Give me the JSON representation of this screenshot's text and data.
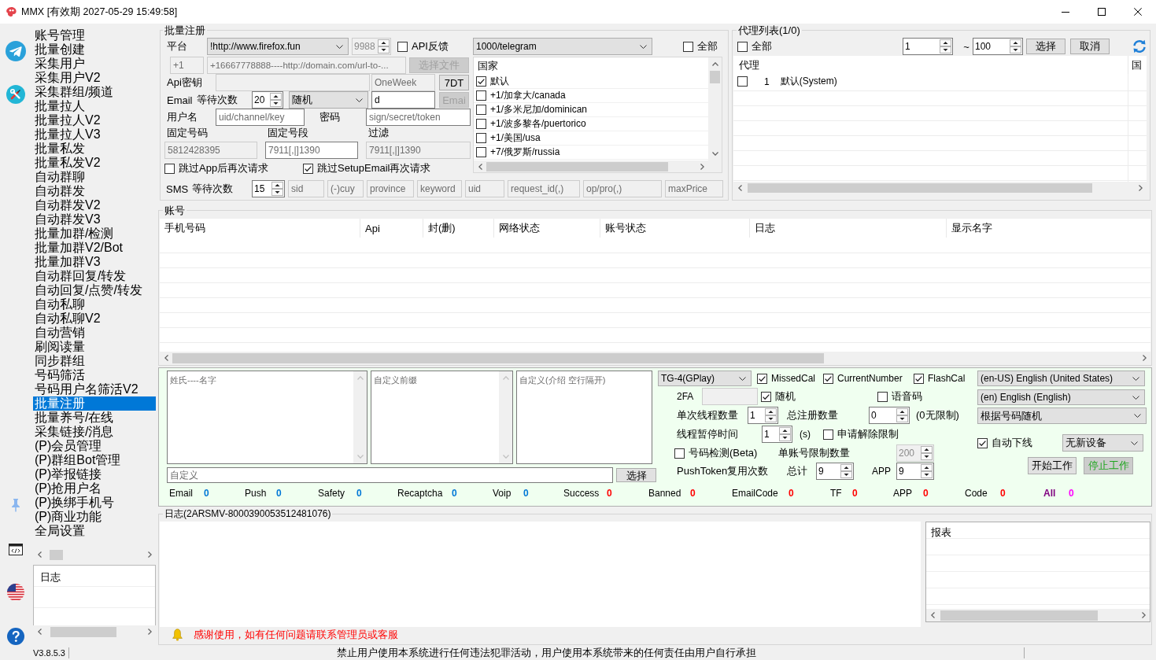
{
  "window": {
    "title": "MMX [有效期 2027-05-29 15:49:58]"
  },
  "sidebar": {
    "items": [
      {
        "label": "账号管理",
        "selected": false
      },
      {
        "label": "批量创建",
        "selected": false
      },
      {
        "label": "采集用户",
        "selected": false
      },
      {
        "label": "采集用户V2",
        "selected": false
      },
      {
        "label": "采集群组/频道",
        "selected": false
      },
      {
        "label": "批量拉人",
        "selected": false
      },
      {
        "label": "批量拉人V2",
        "selected": false
      },
      {
        "label": "批量拉人V3",
        "selected": false
      },
      {
        "label": "批量私发",
        "selected": false
      },
      {
        "label": "批量私发V2",
        "selected": false
      },
      {
        "label": "自动群聊",
        "selected": false
      },
      {
        "label": "自动群发",
        "selected": false
      },
      {
        "label": "自动群发V2",
        "selected": false
      },
      {
        "label": "自动群发V3",
        "selected": false
      },
      {
        "label": "批量加群/检测",
        "selected": false
      },
      {
        "label": "批量加群V2/Bot",
        "selected": false
      },
      {
        "label": "批量加群V3",
        "selected": false
      },
      {
        "label": "自动群回复/转发",
        "selected": false
      },
      {
        "label": "自动回复/点赞/转发",
        "selected": false
      },
      {
        "label": "自动私聊",
        "selected": false
      },
      {
        "label": "自动私聊V2",
        "selected": false
      },
      {
        "label": "自动营销",
        "selected": false
      },
      {
        "label": "刷阅读量",
        "selected": false
      },
      {
        "label": "同步群组",
        "selected": false
      },
      {
        "label": "号码筛活",
        "selected": false
      },
      {
        "label": "号码用户名筛活V2",
        "selected": false
      },
      {
        "label": "批量注册",
        "selected": true
      },
      {
        "label": "批量养号/在线",
        "selected": false
      },
      {
        "label": "采集链接/消息",
        "selected": false
      },
      {
        "label": "(P)会员管理",
        "selected": false
      },
      {
        "label": "(P)群组Bot管理",
        "selected": false
      },
      {
        "label": "(P)举报链接",
        "selected": false
      },
      {
        "label": "(P)抢用户名",
        "selected": false
      },
      {
        "label": "(P)换绑手机号",
        "selected": false
      },
      {
        "label": "(P)商业功能",
        "selected": false
      },
      {
        "label": "全局设置",
        "selected": false
      }
    ],
    "log": {
      "header": "日志"
    }
  },
  "register": {
    "title": "批量注册",
    "platform": {
      "label": "平台",
      "source": "!http://www.firefox.fun",
      "port": {
        "value": "9988",
        "disabled": true
      },
      "api_feedback": {
        "label": "API反馈",
        "checked": false
      }
    },
    "numbers": {
      "prefix": {
        "placeholder": "+1",
        "disabled": true
      },
      "source": {
        "placeholder": "+16667778888----http://domain.com/url-to-...",
        "disabled": true
      },
      "file_button": {
        "label": "选择文件",
        "disabled": true
      }
    },
    "api_key": {
      "label": "Api密钥",
      "key_field": {
        "disabled": true
      },
      "period": {
        "placeholder": "OneWeek",
        "disabled": true
      },
      "button": {
        "label": "7DT",
        "disabled": false
      }
    },
    "email": {
      "label": "Email",
      "wait_label": "等待次数",
      "wait": {
        "value": "20",
        "disabled": false
      },
      "mode": "随机",
      "domain": {
        "value": "d",
        "disabled": false
      },
      "button": {
        "label": "Emai",
        "disabled": true
      }
    },
    "credentials": {
      "username_label": "用户名",
      "username": {
        "placeholder": "uid/channel/key",
        "disabled": false
      },
      "password_label": "密码",
      "password": {
        "placeholder": "sign/secret/token",
        "disabled": false
      }
    },
    "fixed": [
      {
        "label": "固定号码",
        "field": {
          "placeholder": "5812428395",
          "disabled": true
        }
      },
      {
        "label": "固定号段",
        "field": {
          "placeholder": "7911[,|]1390",
          "disabled": false
        }
      },
      {
        "label": "过滤",
        "field": {
          "placeholder": "7911[,|]1390",
          "disabled": true
        }
      }
    ],
    "skip_options": [
      {
        "label": "跳过App后再次请求",
        "checked": false
      },
      {
        "label": "跳过SetupEmail再次请求",
        "checked": true
      }
    ],
    "app": {
      "value": "1000/telegram",
      "all": {
        "label": "全部",
        "checked": false
      }
    },
    "countries": {
      "header": "国家",
      "items": [
        {
          "label": "默认",
          "checked": true
        },
        {
          "label": "+1/加拿大/canada",
          "checked": false
        },
        {
          "label": "+1/多米尼加/dominican",
          "checked": false
        },
        {
          "label": "+1/波多黎各/puertorico",
          "checked": false
        },
        {
          "label": "+1/美国/usa",
          "checked": false
        },
        {
          "label": "+7/俄罗斯/russia",
          "checked": false
        }
      ]
    },
    "sms": {
      "label": "SMS",
      "wait_label": "等待次数",
      "wait": {
        "value": "15",
        "disabled": false
      },
      "fields": [
        {
          "placeholder": "sid",
          "disabled": true
        },
        {
          "placeholder": "(-)cuy",
          "disabled": true
        },
        {
          "placeholder": "province",
          "disabled": true
        },
        {
          "placeholder": "keyword",
          "disabled": true
        },
        {
          "placeholder": "uid",
          "disabled": true
        },
        {
          "placeholder": "request_id(,)",
          "disabled": true
        },
        {
          "placeholder": "op/pro(,)",
          "disabled": true
        },
        {
          "placeholder": "maxPrice",
          "disabled": true
        }
      ]
    }
  },
  "proxy": {
    "title": "代理列表(1/0)",
    "all": {
      "label": "全部",
      "checked": false
    },
    "range_from": {
      "value": "1",
      "disabled": false
    },
    "range_separator": "~",
    "range_to": {
      "value": "100",
      "disabled": false
    },
    "buttons": [
      {
        "label": "选择",
        "disabled": false
      },
      {
        "label": "取消",
        "disabled": false
      }
    ],
    "columns": [
      "代理",
      "国"
    ],
    "rows": [
      {
        "checked": false,
        "index": "1",
        "name": "默认(System)"
      }
    ]
  },
  "accounts": {
    "title": "账号",
    "columns": [
      "手机号码",
      "Api",
      "封(删)",
      "网络状态",
      "账号状态",
      "日志",
      "显示名字"
    ]
  },
  "settings": {
    "text_areas": [
      {
        "placeholder": "姓氏----名字",
        "scrollable": true
      },
      {
        "placeholder": "自定义前缀",
        "scrollable": true
      },
      {
        "placeholder": "自定义(介绍 空行隔开)",
        "scrollable": false
      }
    ],
    "custom": {
      "field": {
        "placeholder": "自定义",
        "disabled": false
      },
      "button": {
        "label": "选择",
        "disabled": false
      }
    },
    "client": "TG-4(GPlay)",
    "flags": [
      {
        "label": "MissedCal",
        "checked": true
      },
      {
        "label": "CurrentNumber",
        "checked": true
      },
      {
        "label": "FlashCal",
        "checked": true
      }
    ],
    "two_fa": {
      "label": "2FA",
      "field": {
        "disabled": true
      },
      "random": {
        "label": "随机",
        "checked": true
      },
      "voice": {
        "label": "语音码",
        "checked": false
      }
    },
    "threads": {
      "label": "单次线程数量",
      "spin": {
        "value": "1",
        "disabled": false
      }
    },
    "total": {
      "label": "总注册数量",
      "spin": {
        "value": "0",
        "disabled": false
      },
      "note": "(0无限制)"
    },
    "pause": {
      "label": "线程暂停时间",
      "spin": {
        "value": "1",
        "disabled": false
      },
      "unit": "(s)",
      "unlock": {
        "label": "申请解除限制",
        "checked": false
      }
    },
    "number_check": {
      "label": "号码检测(Beta)",
      "checked": false
    },
    "account_limit": {
      "label": "单账号限制数量",
      "spin": {
        "value": "200",
        "disabled": true
      }
    },
    "push_token": {
      "label": "PushToken复用次数",
      "total_label": "总计",
      "total": {
        "value": "9",
        "disabled": false
      },
      "app_label": "APP",
      "app": {
        "value": "9",
        "disabled": false
      }
    },
    "languages": [
      "(en-US) English (United States)",
      "(en) English (English)",
      "根据号码随机"
    ],
    "auto_logout": {
      "label": "自动下线",
      "checked": true,
      "device": "无新设备"
    },
    "actions": [
      {
        "label": "开始工作",
        "kind": "start"
      },
      {
        "label": "停止工作",
        "kind": "stop"
      }
    ],
    "stats": [
      {
        "label": "Email",
        "value": "0",
        "color": "#0078d7",
        "kind": "count"
      },
      {
        "label": "Push",
        "value": "0",
        "color": "#0078d7",
        "kind": "count"
      },
      {
        "label": "Safety",
        "value": "0",
        "color": "#0078d7",
        "kind": "count"
      },
      {
        "label": "Recaptcha",
        "value": "0",
        "color": "#0078d7",
        "kind": "count"
      },
      {
        "label": "Voip",
        "value": "0",
        "color": "#0078d7",
        "kind": "count"
      },
      {
        "label": "Success",
        "value": "0",
        "color": "#ff0000",
        "kind": "count"
      },
      {
        "label": "Banned",
        "value": "0",
        "color": "#ff0000",
        "kind": "count"
      },
      {
        "label": "EmailCode",
        "value": "0",
        "color": "#ff0000",
        "kind": "count"
      },
      {
        "label": "TF",
        "value": "0",
        "color": "#ff0000",
        "kind": "count"
      },
      {
        "label": "APP",
        "value": "0",
        "color": "#ff0000",
        "kind": "count"
      },
      {
        "label": "Code",
        "value": "0",
        "color": "#ff0000",
        "kind": "count"
      },
      {
        "label": "All",
        "value": "0",
        "color": "#ff00ff",
        "kind": "total"
      }
    ]
  },
  "log": {
    "title": "日志(2ARSMV-8000390053512481076)",
    "report_header": "报表",
    "notice": "感谢使用，如有任何问题请联系管理员或客服"
  },
  "status_bar": {
    "version": "V3.8.5.3",
    "disclaimer": "禁止用户使用本系统进行任何违法犯罪活动，用户使用本系统带来的任何责任由用户自行承担"
  }
}
